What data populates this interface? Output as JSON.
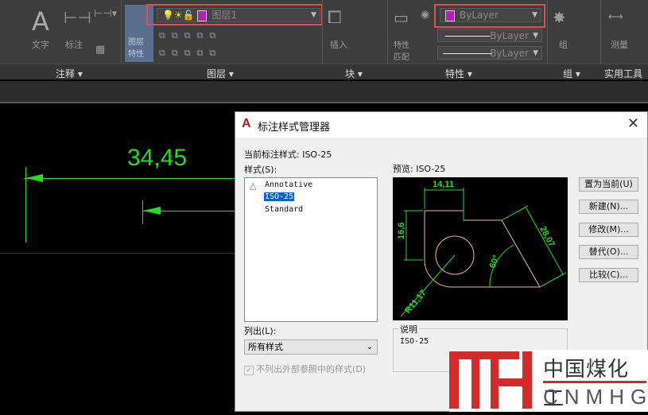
{
  "ribbon": {
    "panels": [
      "注释",
      "图层",
      "块",
      "特性",
      "组",
      "实用工具"
    ],
    "tools": {
      "text": "文字",
      "dimension": "标注",
      "layer_props": "图层特性",
      "insert": "插入",
      "match_props": "特性匹配",
      "group": "组",
      "measure": "测量"
    },
    "layer_combo": "图层1",
    "color_combo": "ByLayer",
    "linetype_combo": "ByLayer",
    "lineweight_combo": "ByLayer",
    "layer_color": "#b020b0"
  },
  "canvas": {
    "dimension_text": "34,45"
  },
  "dialog": {
    "title": "标注样式管理器",
    "current_style_label": "当前标注样式: ISO-25",
    "styles_label": "样式(S):",
    "styles": [
      "Annotative",
      "ISO-25",
      "Standard"
    ],
    "selected_style": "ISO-25",
    "preview_label": "预览: ISO-25",
    "preview_dims": [
      "14,11",
      "16,6",
      "28,07",
      "60°",
      "R11,17"
    ],
    "buttons": [
      "置为当前(U)",
      "新建(N)...",
      "修改(M)...",
      "替代(O)...",
      "比较(C)..."
    ],
    "list_label": "列出(L):",
    "list_value": "所有样式",
    "checkbox_label": "不列出外部参照中的样式(D)",
    "description_label": "说明",
    "description_value": "ISO-25"
  },
  "watermark": {
    "text": "中国煤化工",
    "sub": "CNMHG"
  }
}
